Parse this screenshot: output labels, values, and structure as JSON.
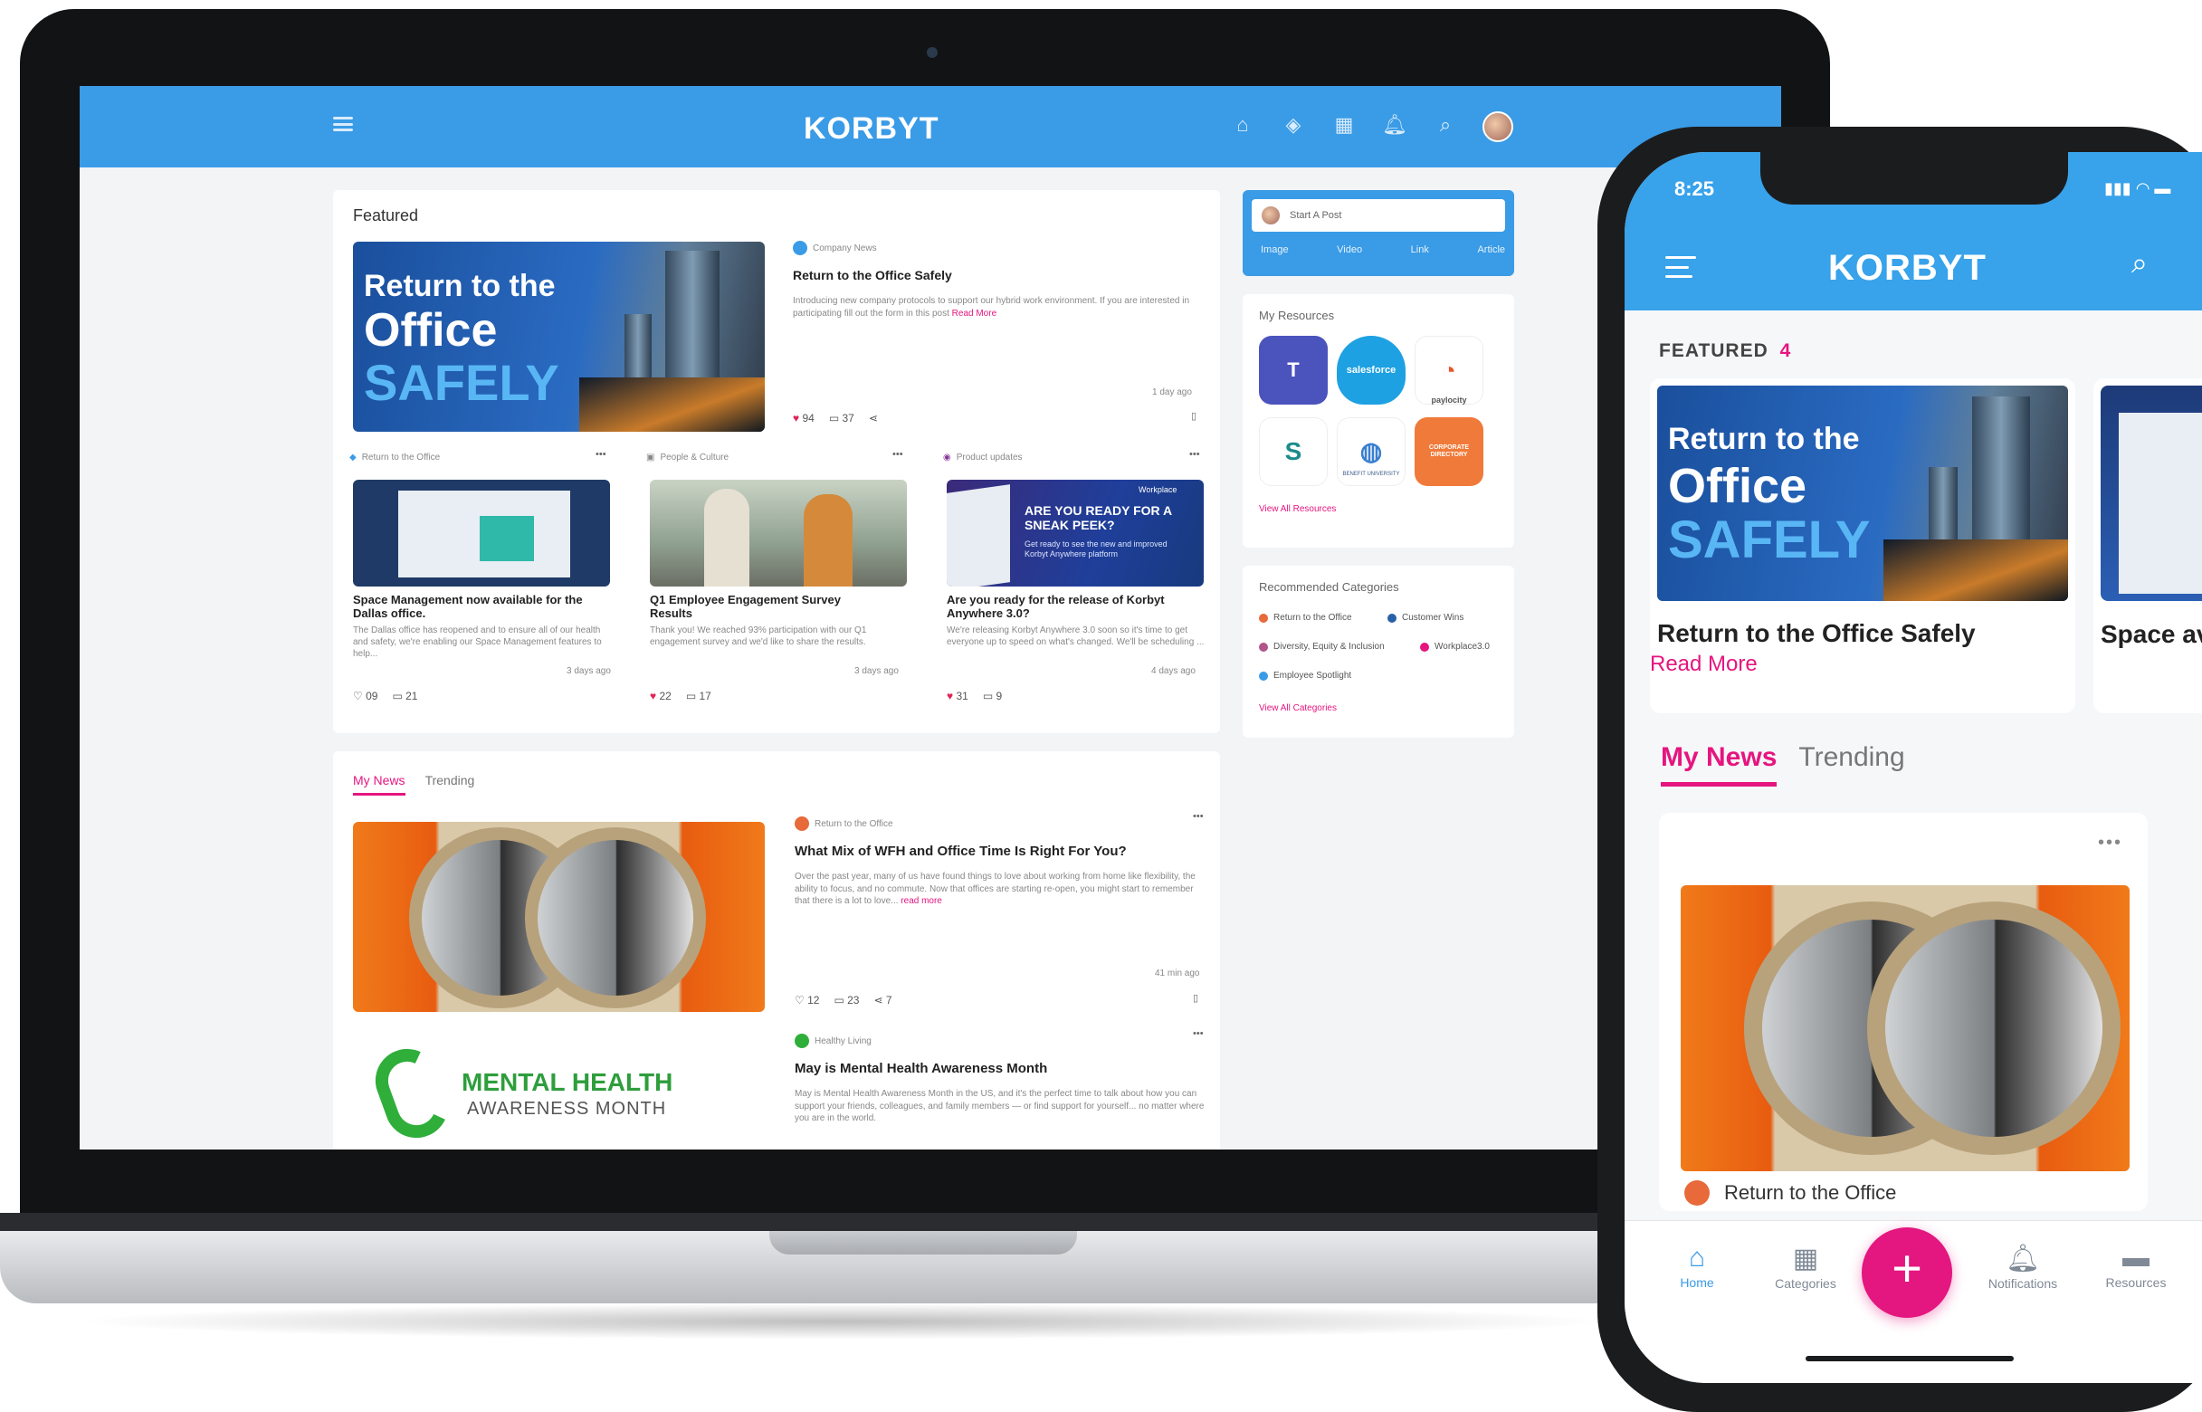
{
  "brand": {
    "logo_text": "KORBYT",
    "accent": "#3a9be6",
    "pink": "#e6157f"
  },
  "web": {
    "featured": {
      "label": "Featured",
      "image_text": {
        "line1": "Return to the",
        "line2": "Office",
        "line3": "SAFELY"
      },
      "source": "Company News",
      "title": "Return to the Office Safely",
      "excerpt": "Introducing new company protocols to support our hybrid work environment. If you are interested in participating fill out the form in this post",
      "read_more": "Read More",
      "age": "1 day ago",
      "likes": "94",
      "comments": "37"
    },
    "posts": [
      {
        "category": "Return to the Office",
        "title": "Space Management now available for the Dallas office.",
        "excerpt": "The Dallas office has reopened and to ensure all of our health and safety, we're enabling our Space Management features to help...",
        "age": "3 days ago",
        "likes": "09",
        "comments": "21"
      },
      {
        "category": "People & Culture",
        "title": "Q1 Employee Engagement Survey Results",
        "excerpt": "Thank you! We reached 93% participation with our Q1 engagement survey and we'd like to share the results.",
        "age": "3 days ago",
        "likes": "22",
        "comments": "17"
      },
      {
        "category": "Product updates",
        "title": "Are you ready for the release of Korbyt Anywhere 3.0?",
        "excerpt": "We're releasing Korbyt Anywhere 3.0 soon so it's time to get everyone up to speed on what's changed. We'll be scheduling ...",
        "age": "4 days ago",
        "likes": "31",
        "comments": "9",
        "image_text": {
          "brand": "Workplace",
          "headline": "ARE YOU READY FOR A SNEAK PEEK?",
          "sub": "Get ready to see the new and improved Korbyt Anywhere platform"
        }
      }
    ],
    "tabs": [
      "My News",
      "Trending"
    ],
    "news": [
      {
        "category": "Return to the Office",
        "title": "What Mix of WFH and Office Time Is Right For You?",
        "excerpt": "Over the past year, many of us have found things to love about working from home like flexibility, the ability to focus, and no commute. Now that offices are starting re-open, you might start to remember that there is a lot to love...",
        "read_more": "read more",
        "age": "41 min ago",
        "likes": "12",
        "comments": "23",
        "shares": "7"
      },
      {
        "category": "Healthy Living",
        "title": "May is Mental Health Awareness Month",
        "excerpt": "May is Mental Health Awareness Month in the US, and it's the perfect time to talk about how you can support your friends, colleagues, and family members — or find support for yourself... no matter where you are in the world.",
        "banner": {
          "line1": "MENTAL HEALTH",
          "line2": "AWARENESS MONTH"
        }
      }
    ],
    "start_post": {
      "placeholder": "Start A Post",
      "actions": [
        "Image",
        "Video",
        "Link",
        "Article"
      ]
    },
    "resources": {
      "title": "My Resources",
      "items": [
        {
          "name": "teams",
          "label": "",
          "color": "#4b53bc"
        },
        {
          "name": "salesforce",
          "label": "salesforce",
          "color": "#1da1e2"
        },
        {
          "name": "paylocity",
          "label": "paylocity",
          "color": "#ffffff"
        },
        {
          "name": "sharepoint",
          "label": "",
          "color": "#1c8c8c"
        },
        {
          "name": "benefit-university",
          "label": "BENEFIT UNIVERSITY",
          "color": "#ffffff"
        },
        {
          "name": "corporate-directory",
          "label": "CORPORATE DIRECTORY",
          "color": "#f07a3a"
        }
      ],
      "view_all": "View All Resources"
    },
    "recommended": {
      "title": "Recommended Categories",
      "items": [
        "Return to the Office",
        "Customer Wins",
        "Diversity, Equity & Inclusion",
        "Workplace3.0",
        "Employee Spotlight"
      ],
      "view_all": "View All Categories"
    }
  },
  "phone": {
    "time": "8:25",
    "status": "▮▮▮ ◠ ▬",
    "featured_label": "FEATURED",
    "featured_count": "4",
    "card": {
      "image_text": {
        "line1": "Return to the",
        "line2": "Office",
        "line3": "SAFELY"
      },
      "title": "Return to the Office Safely",
      "read_more": "Read More"
    },
    "peek_card": {
      "title": "Space availa"
    },
    "tabs": [
      "My News",
      "Trending"
    ],
    "news_category": "Return to the Office",
    "nav": [
      "Home",
      "Categories",
      "Notifications",
      "Resources"
    ],
    "fab": "+"
  }
}
